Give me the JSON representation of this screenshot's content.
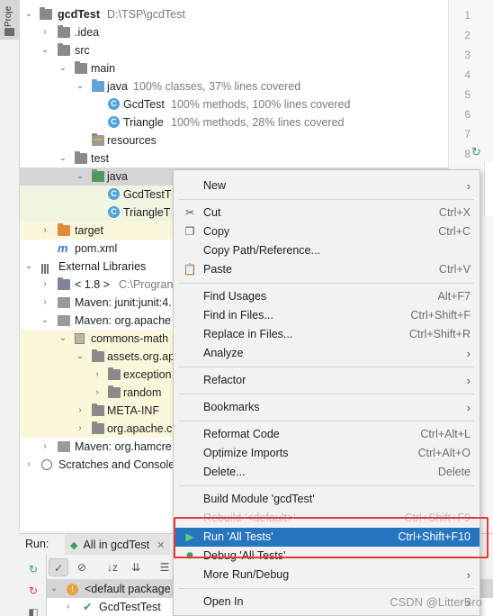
{
  "sidebar": {
    "project_tab_label": "Proje"
  },
  "tree": {
    "root": {
      "name": "gcdTest",
      "path": "D:\\TSP\\gcdTest"
    },
    "idea": ".idea",
    "src": "src",
    "main": "main",
    "main_java": {
      "name": "java",
      "coverage": "100% classes, 37% lines covered"
    },
    "gcdtest_class": {
      "name": "GcdTest",
      "coverage": "100% methods, 100% lines covered"
    },
    "triangle_class": {
      "name": "Triangle",
      "coverage": "100% methods, 28% lines covered"
    },
    "resources": "resources",
    "test": "test",
    "test_java": "java",
    "gcdtest_test": "GcdTestT",
    "triangle_test": "TriangleT",
    "target": "target",
    "pom": "pom.xml",
    "external_libraries": "External Libraries",
    "jdk": {
      "name": "< 1.8 >",
      "path": "C:\\Progran"
    },
    "maven_junit": "Maven: junit:junit:4.",
    "maven_apache": "Maven: org.apache",
    "commons_math": "commons-math",
    "assets": "assets.org.ap",
    "exception": "exception",
    "random": "random",
    "meta_inf": "META-INF",
    "org_apache": "org.apache.c",
    "maven_hamcrest": "Maven: org.hamcre",
    "scratches": "Scratches and Console"
  },
  "gutter": {
    "line_numbers": [
      "1",
      "2",
      "3",
      "4",
      "5",
      "6",
      "7",
      "8"
    ]
  },
  "run_panel": {
    "label": "Run:",
    "tab_label": "All in gcdTest",
    "tree_rows": [
      "<default package",
      "GcdTestTest"
    ]
  },
  "context_menu": {
    "items": [
      {
        "label": "New",
        "shortcut": "",
        "submenu": true
      },
      {
        "label": "Cut",
        "shortcut": "Ctrl+X",
        "icon": "scissors-icon"
      },
      {
        "label": "Copy",
        "shortcut": "Ctrl+C",
        "icon": "copy-icon"
      },
      {
        "label": "Copy Path/Reference...",
        "shortcut": ""
      },
      {
        "label": "Paste",
        "shortcut": "Ctrl+V",
        "icon": "clipboard-icon"
      },
      {
        "label": "Find Usages",
        "shortcut": "Alt+F7"
      },
      {
        "label": "Find in Files...",
        "shortcut": "Ctrl+Shift+F"
      },
      {
        "label": "Replace in Files...",
        "shortcut": "Ctrl+Shift+R"
      },
      {
        "label": "Analyze",
        "shortcut": "",
        "submenu": true
      },
      {
        "label": "Refactor",
        "shortcut": "",
        "submenu": true
      },
      {
        "label": "Bookmarks",
        "shortcut": "",
        "submenu": true
      },
      {
        "label": "Reformat Code",
        "shortcut": "Ctrl+Alt+L"
      },
      {
        "label": "Optimize Imports",
        "shortcut": "Ctrl+Alt+O"
      },
      {
        "label": "Delete...",
        "shortcut": "Delete"
      },
      {
        "label": "Build Module 'gcdTest'",
        "shortcut": ""
      },
      {
        "label": "Rebuild '<default>'",
        "shortcut": "Ctrl+Shift+F9"
      },
      {
        "label": "Run 'All Tests'",
        "shortcut": "Ctrl+Shift+F10",
        "icon": "run-icon"
      },
      {
        "label": "Debug 'All Tests'",
        "shortcut": "",
        "icon": "debug-icon"
      },
      {
        "label": "More Run/Debug",
        "shortcut": "",
        "submenu": true
      },
      {
        "label": "Open In",
        "shortcut": "",
        "submenu": true
      }
    ]
  },
  "watermark": "CSDN @LitterBro",
  "colors": {
    "selection": "#2675bf",
    "highlight_box": "#e53935",
    "run_green": "#3a9e57"
  }
}
